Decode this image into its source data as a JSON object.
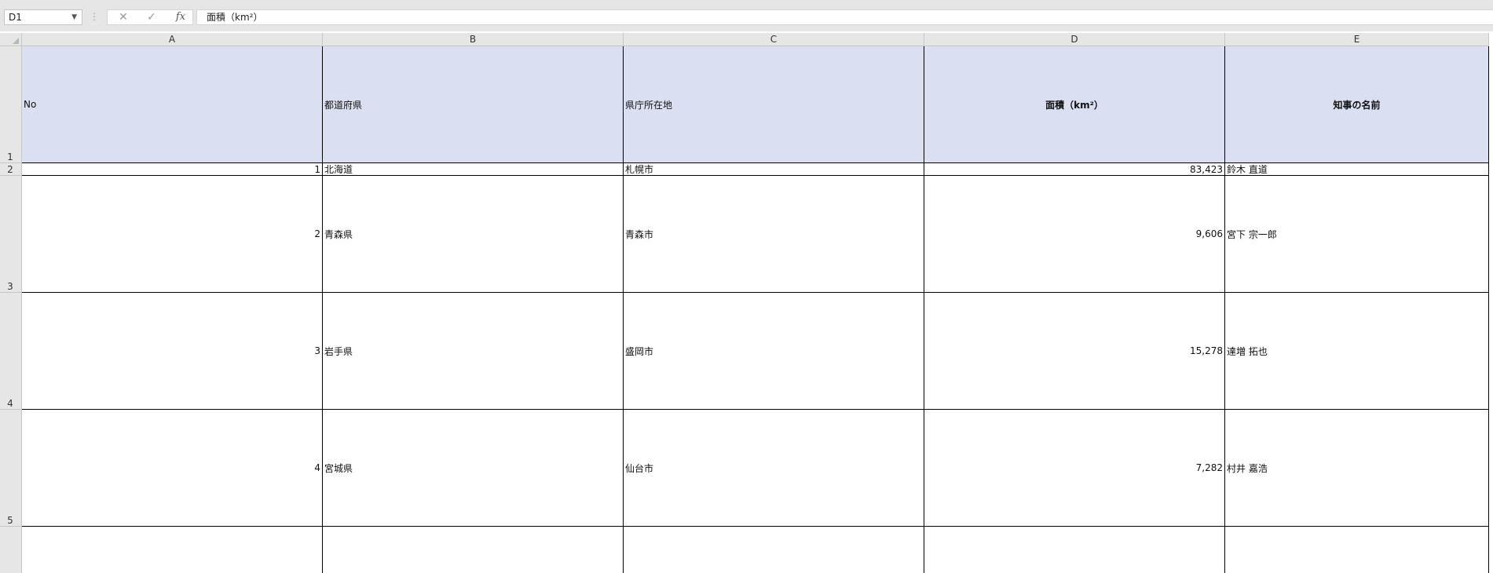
{
  "formula_bar": {
    "name_box": "D1",
    "formula": "面積（km²）",
    "cancel_icon": "✕",
    "enter_icon": "✓",
    "function_icon": "fx"
  },
  "columns": [
    "A",
    "B",
    "C",
    "D",
    "E"
  ],
  "rows": [
    "1",
    "2",
    "3",
    "4",
    "5"
  ],
  "header_cells": {
    "a": "No",
    "b": "都道府県",
    "c": "県庁所在地",
    "d": "面積（km²）",
    "e": "知事の名前"
  },
  "data_rows": [
    {
      "no": "1",
      "prefecture": "北海道",
      "capital": "札幌市",
      "area": "83,423",
      "governor": "鈴木 直道"
    },
    {
      "no": "2",
      "prefecture": "青森県",
      "capital": "青森市",
      "area": "9,606",
      "governor": "宮下 宗一郎"
    },
    {
      "no": "3",
      "prefecture": "岩手県",
      "capital": "盛岡市",
      "area": "15,278",
      "governor": "達増 拓也"
    },
    {
      "no": "4",
      "prefecture": "宮城県",
      "capital": "仙台市",
      "area": "7,282",
      "governor": "村井 嘉浩"
    }
  ],
  "colors": {
    "header_fill": "#dae0f1",
    "ui_gray": "#e6e6e6"
  }
}
